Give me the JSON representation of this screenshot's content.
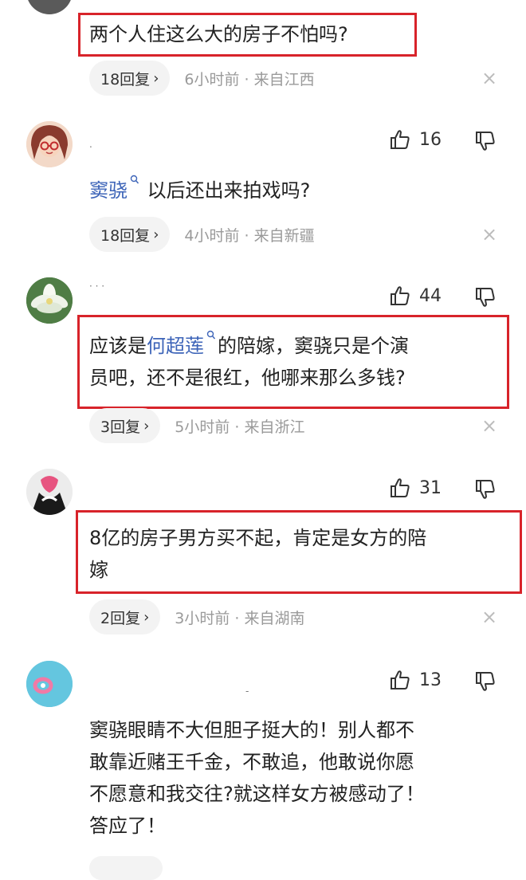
{
  "comments": [
    {
      "text": "两个人住这么大的房子不怕吗?",
      "reply_label": "18回复",
      "time_location": "6小时前 · 来自江西"
    },
    {
      "username": "‧",
      "likes": "16",
      "mention": "窦骁",
      "text_after": "以后还出来拍戏吗?",
      "reply_label": "18回复",
      "time_location": "4小时前 · 来自新疆"
    },
    {
      "username": "· · ·",
      "likes": "44",
      "text_before": "应该是",
      "mention": "何超莲",
      "text_line1_after": "的陪嫁，窦骁只是个演",
      "text_line2": "员吧，还不是很红，他哪来那么多钱?",
      "reply_label": "3回复",
      "time_location": "5小时前 · 来自浙江"
    },
    {
      "likes": "31",
      "text_line1": "8亿的房子男方买不起，肯定是女方的陪",
      "text_line2": "嫁",
      "reply_label": "2回复",
      "time_location": "3小时前 · 来自湖南"
    },
    {
      "username": "-",
      "likes": "13",
      "text_line1": "窦骁眼睛不大但胆子挺大的！别人都不",
      "text_line2": "敢靠近赌王千金，不敢追，他敢说你愿",
      "text_line3": "不愿意和我交往?就这样女方被感动了！",
      "text_line4": "答应了！"
    }
  ],
  "icons": {
    "like": "thumbs-up-icon",
    "dislike": "thumbs-down-icon",
    "close": "close-icon",
    "chevron": "chevron-right-icon",
    "search": "search-icon"
  },
  "symbols": {
    "chevron": "›",
    "close": "×"
  },
  "colors": {
    "highlight_border": "#d8232a",
    "mention": "#3d64b8",
    "meta": "#9a9a9a",
    "pill_bg": "#f3f3f3"
  }
}
